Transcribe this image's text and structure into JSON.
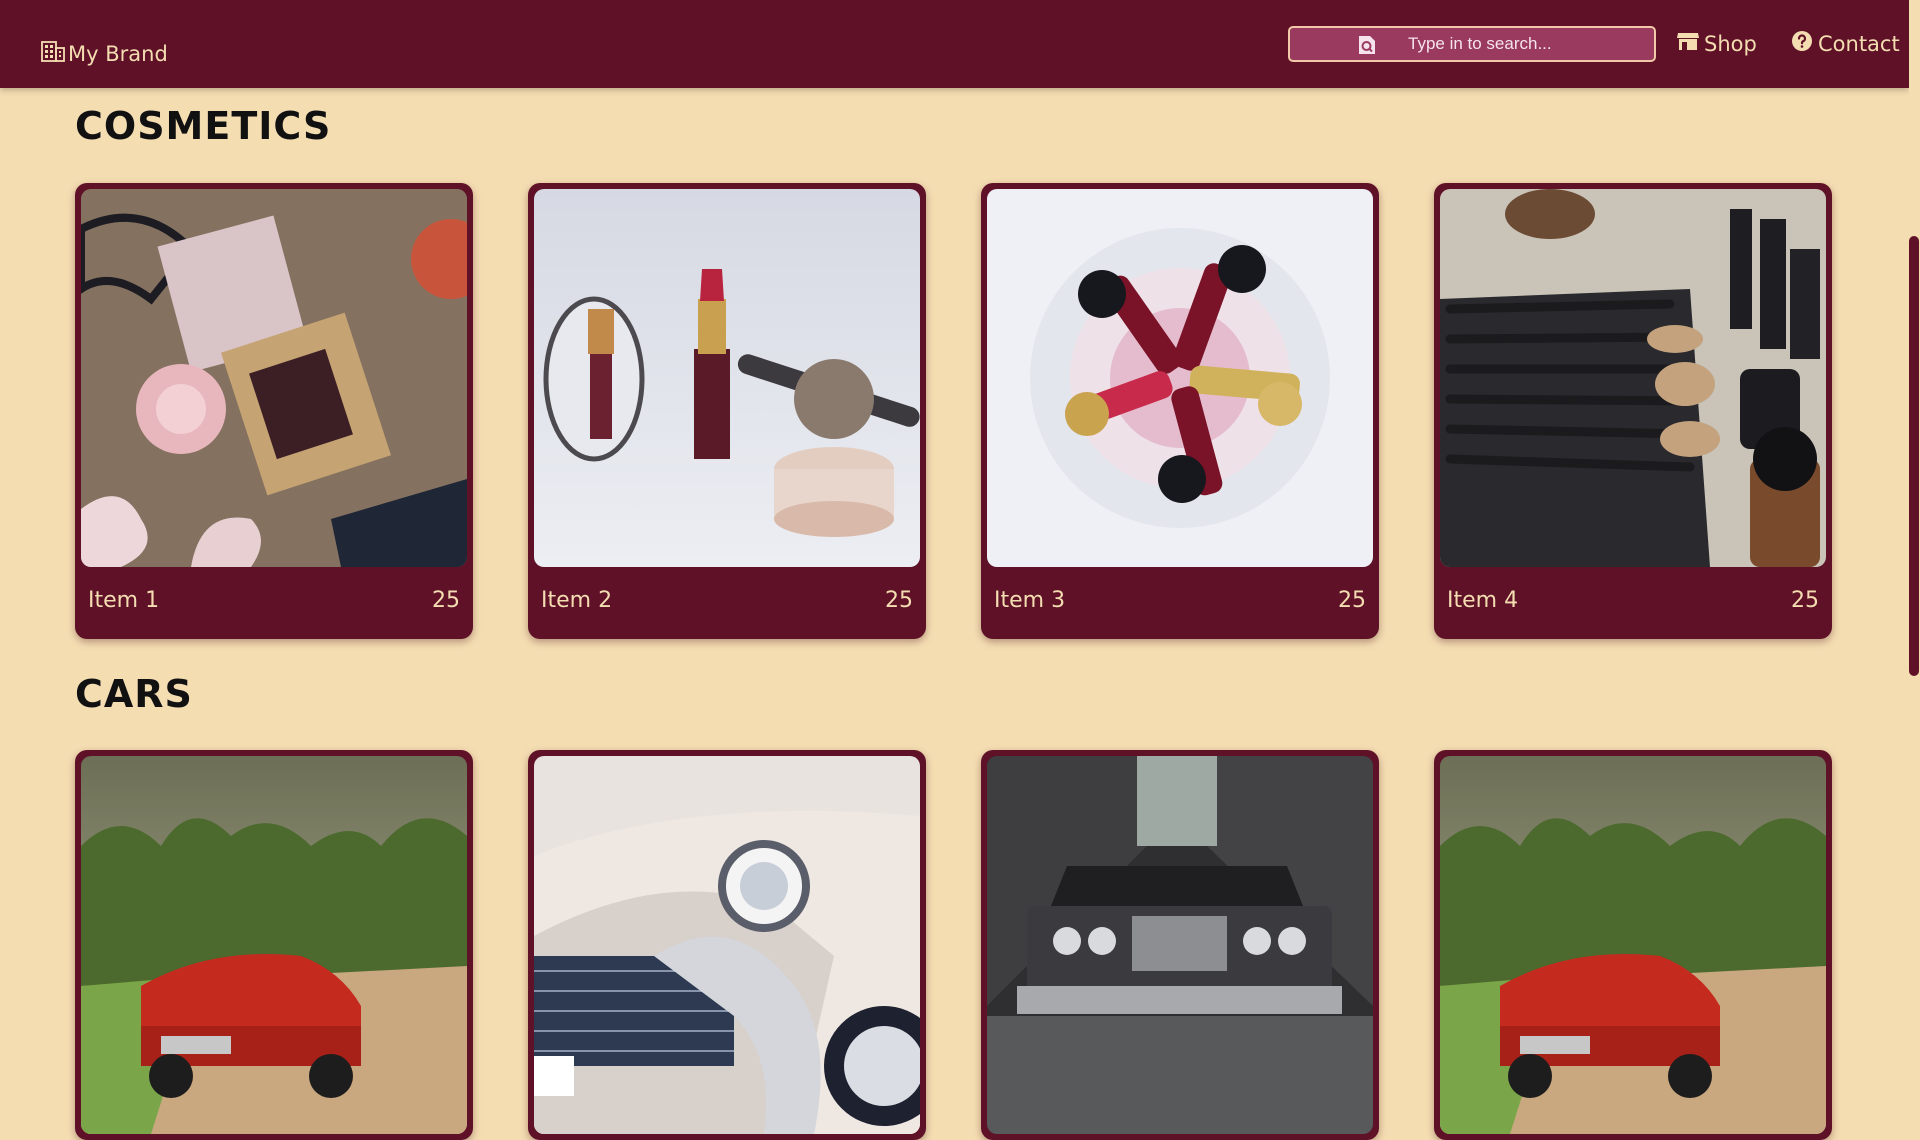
{
  "header": {
    "brand": "My Brand",
    "search_placeholder": "Type in to search...",
    "nav": [
      {
        "label": "Shop",
        "icon": "store-icon"
      },
      {
        "label": "Contact",
        "icon": "question-circle-icon"
      }
    ]
  },
  "sections": [
    {
      "title": "COSMETICS",
      "items": [
        {
          "name": "Item 1",
          "price": "25",
          "image": "makeup-flatlay"
        },
        {
          "name": "Item 2",
          "price": "25",
          "image": "lipstick-mirror-powder"
        },
        {
          "name": "Item 3",
          "price": "25",
          "image": "lipsticks-in-glass"
        },
        {
          "name": "Item 4",
          "price": "25",
          "image": "makeup-brushes"
        }
      ]
    },
    {
      "title": "CARS",
      "items": [
        {
          "image": "red-convertible"
        },
        {
          "image": "white-classic-car"
        },
        {
          "image": "dark-sedan-alley"
        },
        {
          "image": "red-convertible"
        }
      ]
    }
  ],
  "colors": {
    "accent": "#5e1127",
    "background": "#f5ddb2",
    "search_bg": "#9a3a5e"
  }
}
